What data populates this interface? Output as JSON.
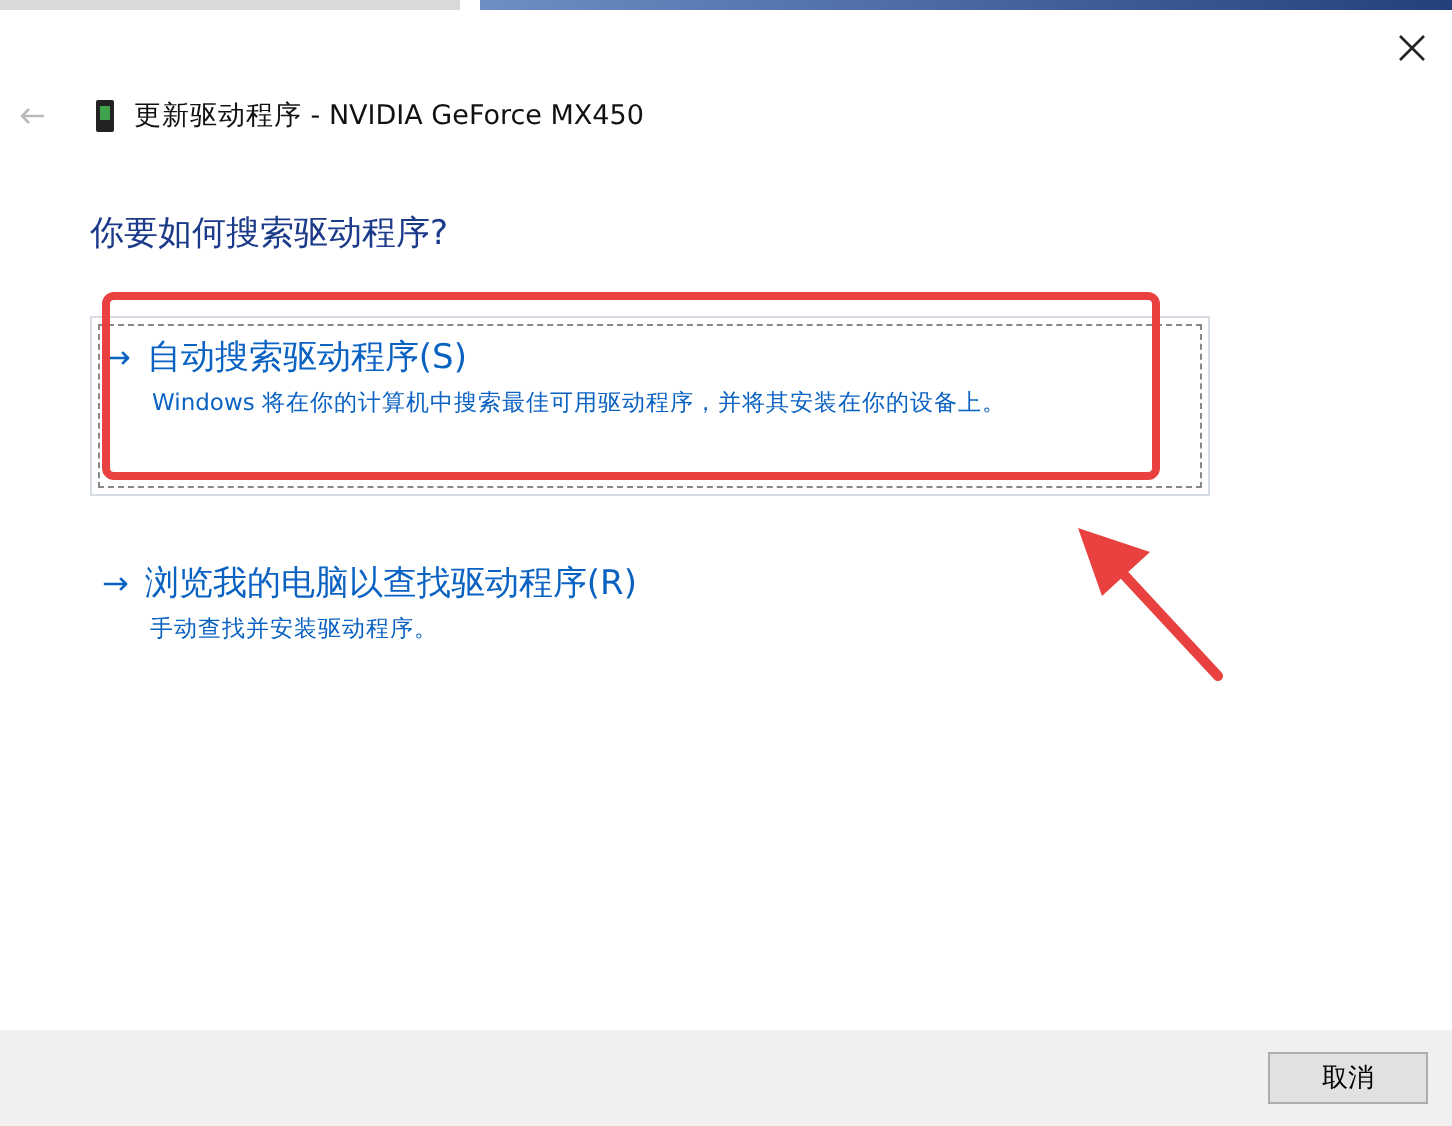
{
  "window": {
    "title": "更新驱动程序 - NVIDIA GeForce MX450"
  },
  "heading": "你要如何搜索驱动程序?",
  "options": [
    {
      "arrow": "→",
      "label": "自动搜索驱动程序(S)",
      "description": "Windows 将在你的计算机中搜索最佳可用驱动程序，并将其安装在你的设备上。",
      "focused": true,
      "highlighted": true
    },
    {
      "arrow": "→",
      "label": "浏览我的电脑以查找驱动程序(R)",
      "description": "手动查找并安装驱动程序。",
      "focused": false,
      "highlighted": false
    }
  ],
  "buttons": [
    "取消"
  ]
}
